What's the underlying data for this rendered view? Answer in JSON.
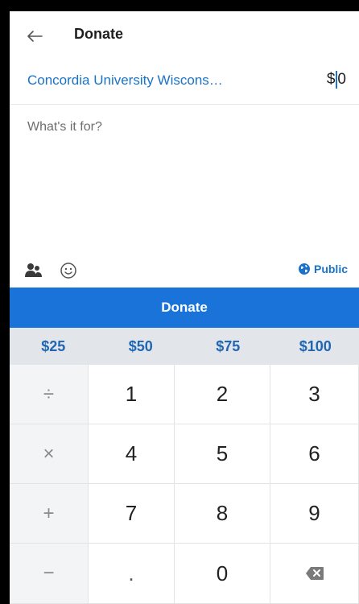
{
  "header": {
    "title": "Donate",
    "back_icon": "arrow-left-icon"
  },
  "recipient": {
    "name": "Concordia University Wiscons…",
    "currency_symbol": "$",
    "amount": "0"
  },
  "memo": {
    "placeholder": "What's it for?"
  },
  "toolbar": {
    "privacy_label": "Public",
    "icons": [
      "friends-icon",
      "emoji-icon",
      "globe-icon"
    ]
  },
  "action": {
    "donate_label": "Donate"
  },
  "quick_amounts": [
    "$25",
    "$50",
    "$75",
    "$100"
  ],
  "keypad": {
    "operators": [
      "÷",
      "×",
      "+",
      "−"
    ],
    "row1": [
      "1",
      "2",
      "3"
    ],
    "row2": [
      "4",
      "5",
      "6"
    ],
    "row3": [
      "7",
      "8",
      "9"
    ],
    "row4": [
      ".",
      "0"
    ],
    "backspace_icon": "backspace-icon"
  },
  "colors": {
    "accent": "#1a73d9",
    "link": "#1a73c8",
    "quick_bar": "#e2e5ea"
  }
}
